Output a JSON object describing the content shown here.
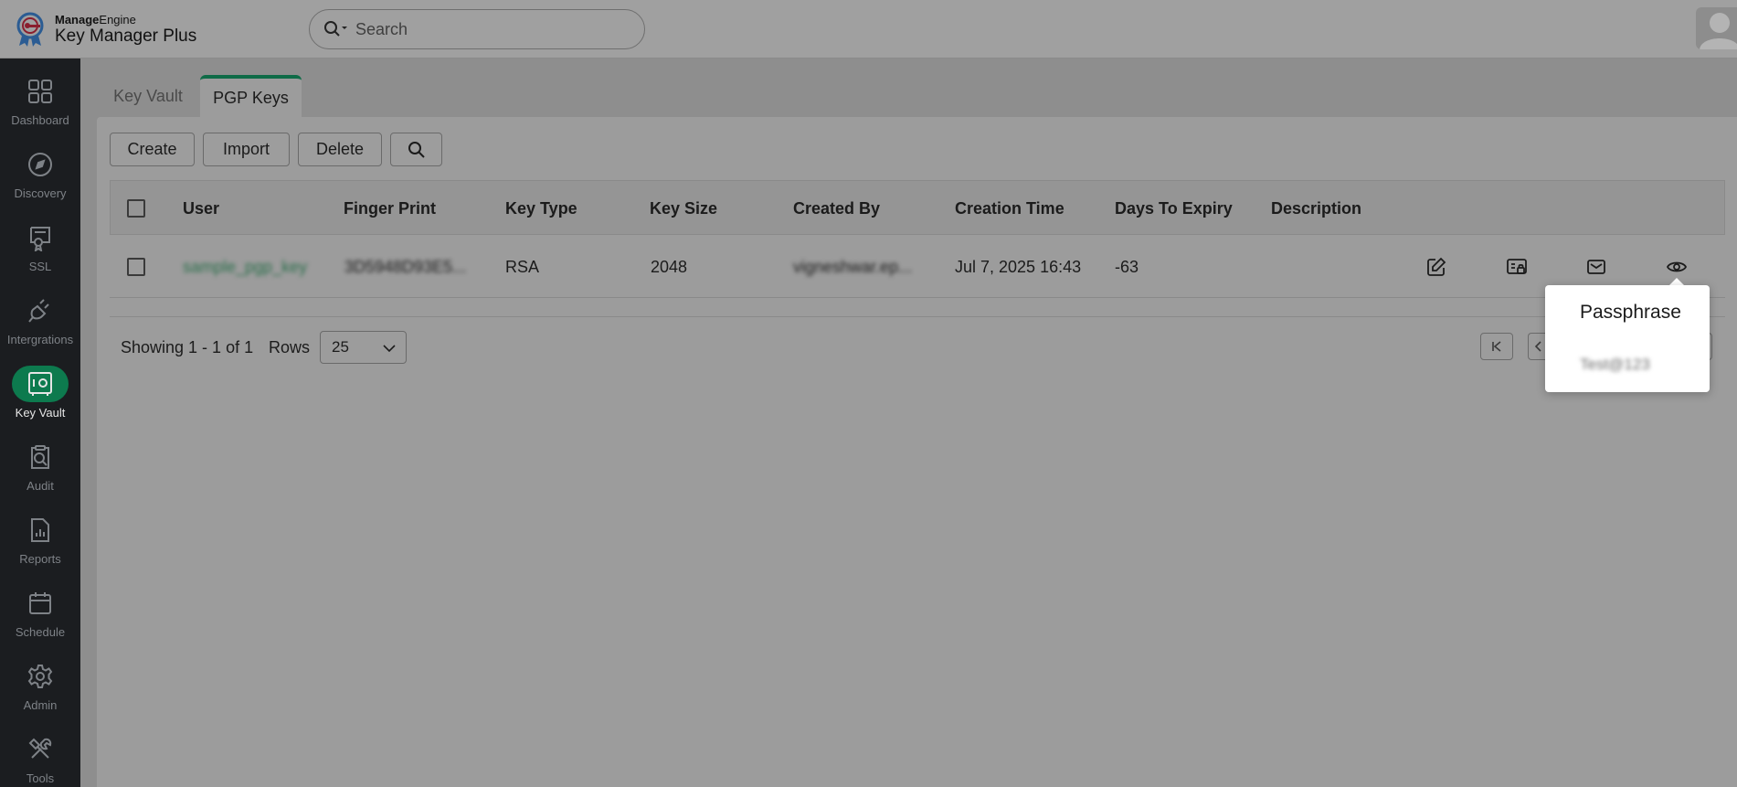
{
  "app": {
    "brand": "ManageEngine",
    "brand_bold": "Manage",
    "brand_rest": "Engine",
    "product": "Key Manager Plus"
  },
  "search": {
    "placeholder": "Search"
  },
  "sidebar": {
    "items": [
      {
        "label": "Dashboard",
        "icon": "dashboard-icon"
      },
      {
        "label": "Discovery",
        "icon": "compass-icon"
      },
      {
        "label": "SSL",
        "icon": "certificate-icon"
      },
      {
        "label": "Intergrations",
        "icon": "plug-icon"
      },
      {
        "label": "Key Vault",
        "icon": "vault-icon",
        "active": true
      },
      {
        "label": "Audit",
        "icon": "audit-icon"
      },
      {
        "label": "Reports",
        "icon": "reports-icon"
      },
      {
        "label": "Schedule",
        "icon": "calendar-icon"
      },
      {
        "label": "Admin",
        "icon": "gear-icon"
      },
      {
        "label": "Tools",
        "icon": "tools-icon"
      }
    ]
  },
  "tabs": [
    {
      "label": "Key Vault",
      "active": false
    },
    {
      "label": "PGP Keys",
      "active": true
    }
  ],
  "toolbar": {
    "create_label": "Create",
    "import_label": "Import",
    "delete_label": "Delete"
  },
  "table": {
    "columns": [
      "User",
      "Finger Print",
      "Key Type",
      "Key Size",
      "Created By",
      "Creation Time",
      "Days To Expiry",
      "Description"
    ],
    "rows": [
      {
        "user": "sample_pgp_key",
        "finger_print": "3D5948D93E5...",
        "key_type": "RSA",
        "key_size": "2048",
        "created_by": "vigneshwar.ep...",
        "creation_time": "Jul 7, 2025 16:43",
        "days_to_expiry": "-63",
        "description": ""
      }
    ]
  },
  "footer": {
    "showing": "Showing 1 - 1 of 1",
    "rows_label": "Rows",
    "rows_value": "25"
  },
  "popup": {
    "title": "Passphrase",
    "value": "Test@123"
  },
  "colors": {
    "accent": "#0f6b47",
    "sidebar_bg": "#1b1d20",
    "link": "#2a6e4a"
  }
}
